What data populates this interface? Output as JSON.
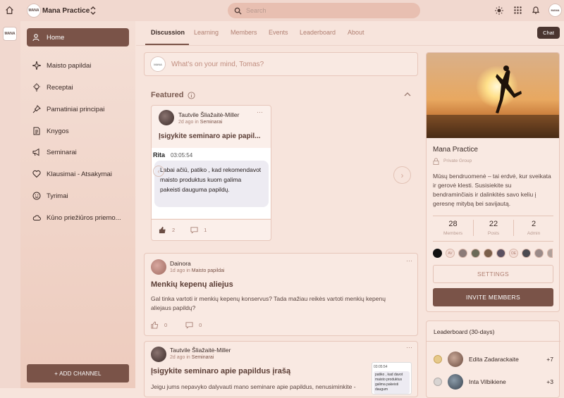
{
  "topbar": {
    "group_name": "Mana Practice",
    "logo_text": "MANA",
    "search_placeholder": "Search"
  },
  "sidebar": {
    "items": [
      {
        "label": "Home",
        "icon": "people-icon",
        "active": true
      },
      {
        "label": "Maisto papildai",
        "icon": "sparkle-icon"
      },
      {
        "label": "Receptai",
        "icon": "lightbulb-icon"
      },
      {
        "label": "Pamatiniai principai",
        "icon": "pin-icon"
      },
      {
        "label": "Knygos",
        "icon": "document-icon"
      },
      {
        "label": "Seminarai",
        "icon": "megaphone-icon"
      },
      {
        "label": "Klausimai - Atsakymai",
        "icon": "heart-icon"
      },
      {
        "label": "Tyrimai",
        "icon": "smiley-icon"
      },
      {
        "label": "Kūno priežiūros priemo...",
        "icon": "cloud-icon"
      }
    ],
    "add_channel": "+ ADD CHANNEL"
  },
  "tabs": [
    "Discussion",
    "Learning",
    "Members",
    "Events",
    "Leaderboard",
    "About"
  ],
  "chat_button": "Chat",
  "composer": {
    "placeholder": "What's on your mind, Tomas?"
  },
  "featured": {
    "title": "Featured",
    "card": {
      "author": "Tautvile Šliažaitė-Miller",
      "time": "2d ago",
      "in": "in",
      "channel": "Seminarai",
      "title": "Įsigykite seminaro apie papil...",
      "preview_name": "Rita",
      "preview_time": "03:05:54",
      "preview_text": "Labai ačiū, patiko , kad rekomendavot maisto produktus kuom galima pakeisti dauguma papildų.",
      "likes": "2",
      "comments": "1"
    }
  },
  "posts": [
    {
      "author": "Dainora",
      "time": "1d ago",
      "in": "in",
      "channel": "Maisto papildai",
      "title": "Menkių kepenų aliejus",
      "body": "Gal tinka vartoti ir menkių kepenų konservus? Tada mažiau reikės vartoti menkių kepenų aliejaus papildų?",
      "likes": "0",
      "comments": "0"
    },
    {
      "author": "Tautvile Šliažaitė-Miller",
      "time": "2d ago",
      "in": "in",
      "channel": "Seminarai",
      "title": "Įsigykite seminaro apie papildus įrašą",
      "body": "Jeigu jums nepavyko dalyvauti mano seminare apie papildus, nenusiminkite -",
      "thumb_time": "03:05:54",
      "thumb_text": "patiko , kad davot maisto produktus galima pakeisti daugum"
    }
  ],
  "group": {
    "name": "Mana Practice",
    "privacy": "Private Group",
    "description": "Mūsų bendruomenė – tai erdvė, kur sveikata ir gerovė klesti. Susisiekite su bendraminčiais ir dalinkitės savo keliu į geresnę mitybą bei savijautą.",
    "stats": [
      {
        "value": "28",
        "label": "Members"
      },
      {
        "value": "22",
        "label": "Posts"
      },
      {
        "value": "2",
        "label": "Admin"
      }
    ],
    "member_initials": [
      "AV",
      "OE"
    ],
    "settings_label": "SETTINGS",
    "invite_label": "INVITE MEMBERS"
  },
  "leaderboard": {
    "title": "Leaderboard (30-days)",
    "rows": [
      {
        "name": "Edita Zadarackaite",
        "points": "+7"
      },
      {
        "name": "Inta Vilbikiene",
        "points": "+3"
      }
    ]
  },
  "colors": {
    "accent": "#7a5348",
    "background": "#f7e4dc",
    "card": "#f9e9e2",
    "search": "#e8bfb1"
  }
}
